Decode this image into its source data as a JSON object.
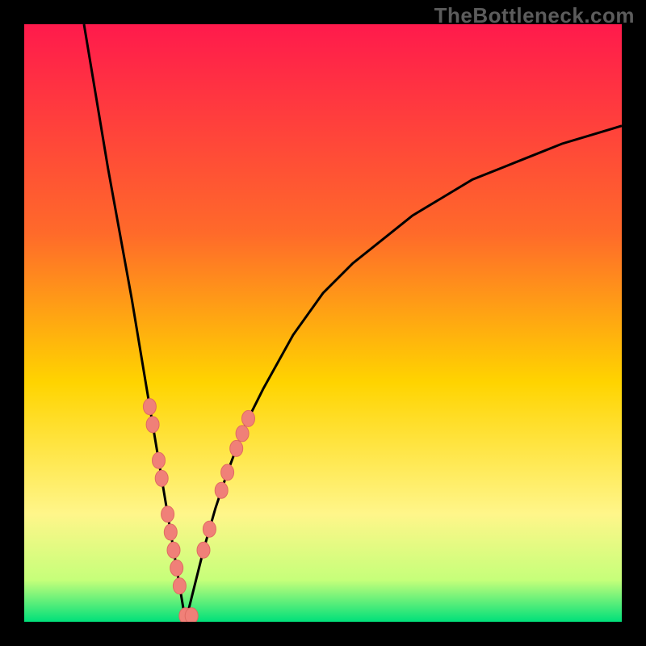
{
  "watermark": "TheBottleneck.com",
  "colors": {
    "gradient_top": "#ff1a4c",
    "gradient_mid1": "#ff6a2a",
    "gradient_mid2": "#ffd400",
    "gradient_mid3": "#fff68a",
    "gradient_low": "#c6ff7a",
    "gradient_bottom": "#00e07a",
    "curve": "#000000",
    "marker_fill": "#f08078",
    "marker_stroke": "#e06a62",
    "frame": "#000000"
  },
  "chart_data": {
    "type": "line",
    "title": "",
    "xlabel": "",
    "ylabel": "",
    "xlim": [
      0,
      100
    ],
    "ylim": [
      0,
      100
    ],
    "apex_x": 27,
    "series": [
      {
        "name": "left-branch",
        "x": [
          10,
          12,
          14,
          16,
          18,
          20,
          21,
          22,
          23,
          24,
          25,
          26,
          27
        ],
        "y": [
          100,
          88,
          76,
          65,
          54,
          42,
          36,
          30,
          24,
          18,
          12,
          6,
          0
        ]
      },
      {
        "name": "right-branch",
        "x": [
          27,
          28,
          29,
          30,
          32,
          34,
          37,
          40,
          45,
          50,
          55,
          60,
          65,
          70,
          75,
          80,
          85,
          90,
          95,
          100
        ],
        "y": [
          0,
          4,
          8,
          12,
          19,
          25,
          33,
          39,
          48,
          55,
          60,
          64,
          68,
          71,
          74,
          76,
          78,
          80,
          81.5,
          83
        ]
      }
    ],
    "markers_left": [
      {
        "x": 21,
        "y": 36
      },
      {
        "x": 21.5,
        "y": 33
      },
      {
        "x": 22.5,
        "y": 27
      },
      {
        "x": 23,
        "y": 24
      },
      {
        "x": 24,
        "y": 18
      },
      {
        "x": 24.5,
        "y": 15
      },
      {
        "x": 25,
        "y": 12
      },
      {
        "x": 25.5,
        "y": 9
      },
      {
        "x": 26,
        "y": 6
      },
      {
        "x": 27,
        "y": 1
      },
      {
        "x": 28,
        "y": 1
      }
    ],
    "markers_right": [
      {
        "x": 30,
        "y": 12
      },
      {
        "x": 31,
        "y": 15.5
      },
      {
        "x": 33,
        "y": 22
      },
      {
        "x": 34,
        "y": 25
      },
      {
        "x": 35.5,
        "y": 29
      },
      {
        "x": 36.5,
        "y": 31.5
      },
      {
        "x": 37.5,
        "y": 34
      }
    ]
  }
}
